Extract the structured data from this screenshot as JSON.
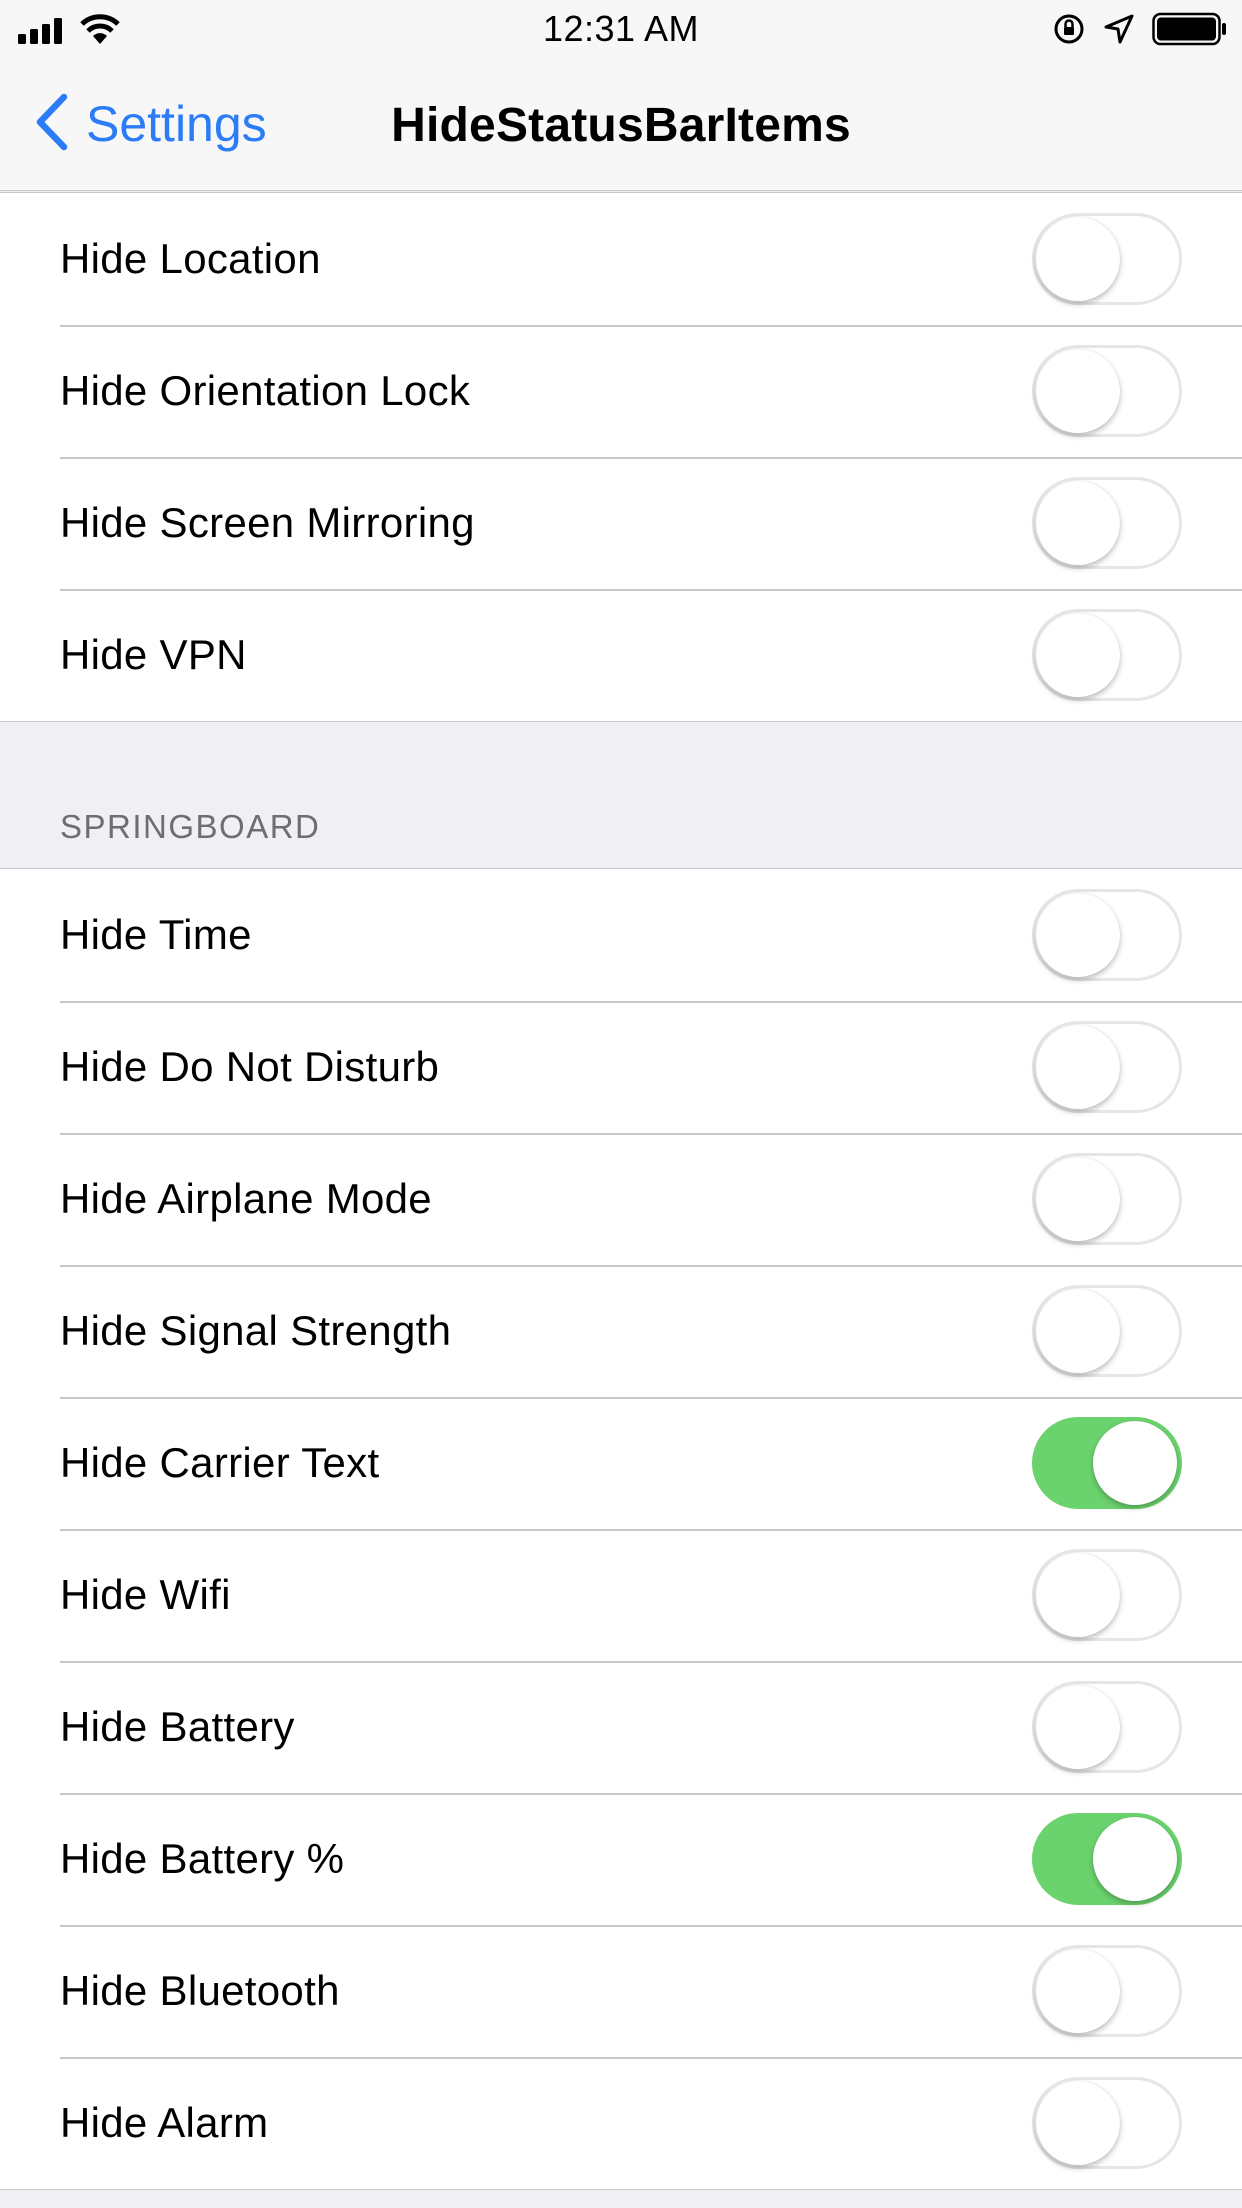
{
  "status_bar": {
    "time": "12:31 AM",
    "icons": [
      "signal-icon",
      "wifi-icon",
      "orientation-lock-icon",
      "location-icon",
      "battery-icon"
    ]
  },
  "nav": {
    "back_label": "Settings",
    "title": "HideStatusBarItems"
  },
  "colors": {
    "accent": "#2b7cf6",
    "toggle_on": "#6bd36d",
    "background": "#efeff4"
  },
  "top_group": {
    "items": [
      {
        "label": "Hide Location",
        "on": false
      },
      {
        "label": "Hide Orientation Lock",
        "on": false
      },
      {
        "label": "Hide Screen Mirroring",
        "on": false
      },
      {
        "label": "Hide VPN",
        "on": false
      }
    ]
  },
  "springboard": {
    "header": "SPRINGBOARD",
    "items": [
      {
        "label": "Hide Time",
        "on": false
      },
      {
        "label": "Hide Do Not Disturb",
        "on": false
      },
      {
        "label": "Hide Airplane Mode",
        "on": false
      },
      {
        "label": "Hide Signal Strength",
        "on": false
      },
      {
        "label": "Hide Carrier Text",
        "on": true
      },
      {
        "label": "Hide Wifi",
        "on": false
      },
      {
        "label": "Hide Battery",
        "on": false
      },
      {
        "label": "Hide Battery %",
        "on": true
      },
      {
        "label": "Hide Bluetooth",
        "on": false
      },
      {
        "label": "Hide Alarm",
        "on": false
      }
    ]
  }
}
